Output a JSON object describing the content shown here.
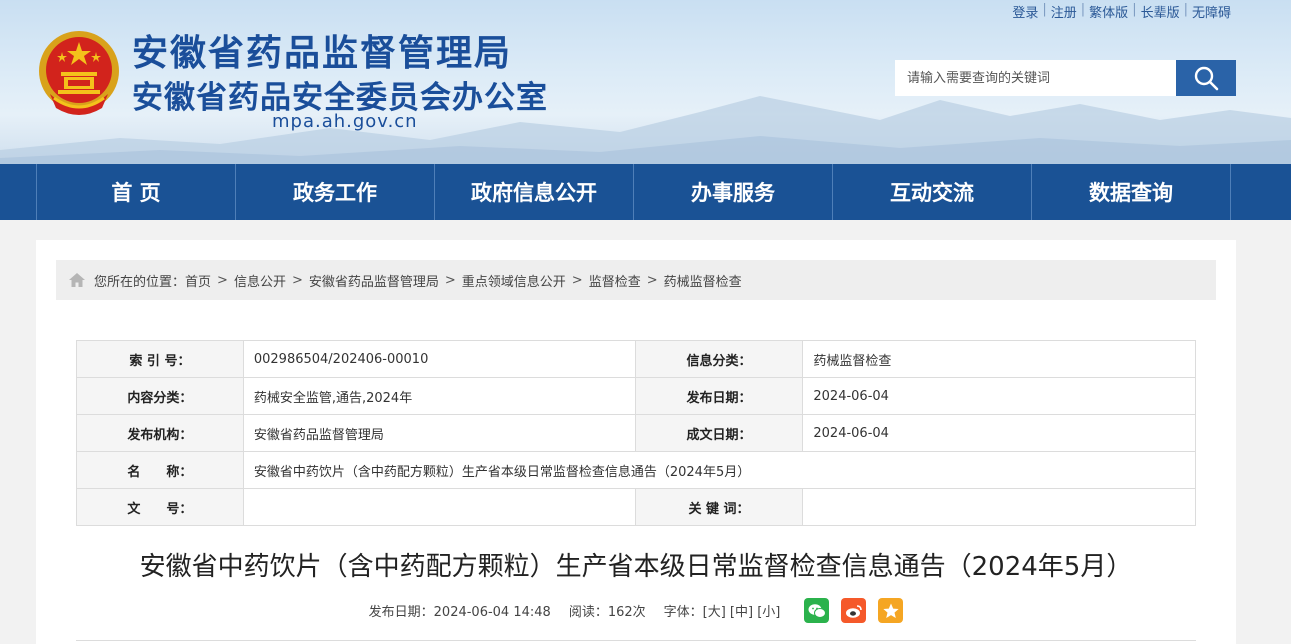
{
  "site": {
    "title_main": "安徽省药品监督管理局",
    "title_sub": "安徽省药品安全委员会办公室",
    "domain": "mpa.ah.gov.cn"
  },
  "top_links": [
    "登录",
    "注册",
    "繁体版",
    "长辈版",
    "无障碍"
  ],
  "search": {
    "placeholder": "请输入需要查询的关键词",
    "icon": "search-icon"
  },
  "nav": [
    "首 页",
    "政务工作",
    "政府信息公开",
    "办事服务",
    "互动交流",
    "数据查询"
  ],
  "breadcrumb": {
    "prefix": "您所在的位置：",
    "items": [
      "首页",
      "信息公开",
      "安徽省药品监督管理局",
      "重点领域信息公开",
      "监督检查",
      "药械监督检查"
    ],
    "separator": ">"
  },
  "meta": {
    "index_label": "索 引 号：",
    "index_value": "002986504/202406-00010",
    "category_label": "信息分类：",
    "category_value": "药械监督检查",
    "content_label": "内容分类：",
    "content_value": "药械安全监管,通告,2024年",
    "pubdate_label": "发布日期：",
    "pubdate_value": "2024-06-04",
    "org_label": "发布机构：",
    "org_value": "安徽省药品监督管理局",
    "created_label": "成文日期：",
    "created_value": "2024-06-04",
    "name_label": "名　　称：",
    "name_value": "安徽省中药饮片（含中药配方颗粒）生产省本级日常监督检查信息通告（2024年5月）",
    "docno_label": "文　　号：",
    "docno_value": "",
    "keywords_label": "关 键 词：",
    "keywords_value": ""
  },
  "article": {
    "title": "安徽省中药饮片（含中药配方颗粒）生产省本级日常监督检查信息通告（2024年5月）",
    "publish": "发布日期：2024-06-04 14:48",
    "views": "阅读：162次",
    "font_size": "字体：[大] [中] [小]",
    "share_icons": [
      "wechat-icon",
      "weibo-icon",
      "favorite-icon"
    ]
  },
  "colors": {
    "nav_bg": "#1a5295",
    "title_blue": "#1a4e9a",
    "wechat": "#2bb24c",
    "weibo": "#f5592a",
    "fav": "#f5a623"
  }
}
